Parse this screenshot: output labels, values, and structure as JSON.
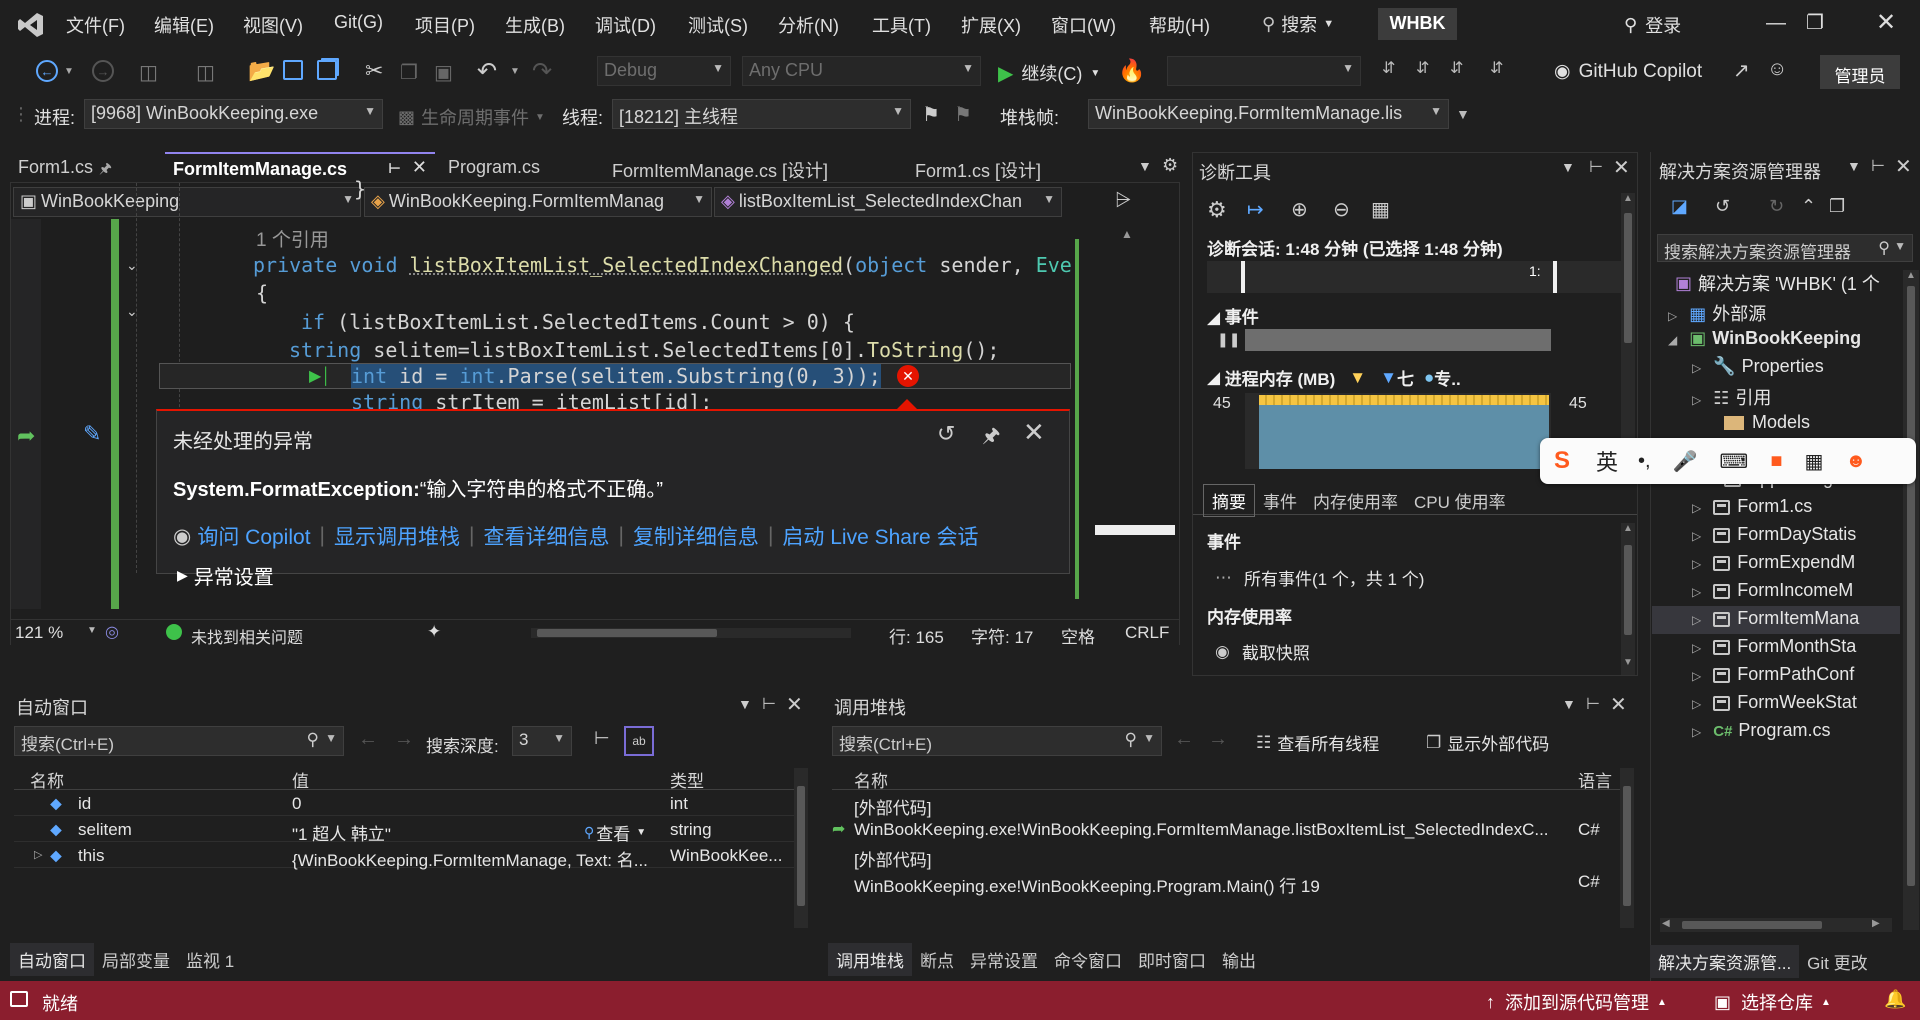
{
  "menubar": {
    "items": [
      "文件(F)",
      "编辑(E)",
      "视图(V)",
      "Git(G)",
      "项目(P)",
      "生成(B)",
      "调试(D)",
      "测试(S)",
      "分析(N)",
      "工具(T)",
      "扩展(X)",
      "窗口(W)",
      "帮助(H)"
    ],
    "search": "搜索",
    "solution_badge": "WHBK",
    "login": "登录"
  },
  "toolbar1": {
    "config": "Debug",
    "platform": "Any CPU",
    "continue": "继续(C)",
    "copilot": "GitHub Copilot",
    "admin": "管理员"
  },
  "toolbar2": {
    "process_label": "进程:",
    "process": "[9968] WinBookKeeping.exe",
    "lifecycle": "生命周期事件",
    "thread_label": "线程:",
    "thread": "[18212] 主线程",
    "stackframe_label": "堆栈帧:",
    "stackframe": "WinBookKeeping.FormItemManage.lis"
  },
  "editor_tabs": [
    {
      "label": "Form1.cs"
    },
    {
      "label": "FormItemManage.cs"
    },
    {
      "label": "Program.cs"
    },
    {
      "label": "FormItemManage.cs [设计]"
    },
    {
      "label": "Form1.cs [设计]"
    }
  ],
  "nav": {
    "project": "WinBookKeeping",
    "class": "WinBookKeeping.FormItemManag",
    "member": "listBoxItemList_SelectedIndexChan"
  },
  "code": {
    "brace_close": "}",
    "refs": "1 个引用",
    "sig_kw": "private void",
    "sig_name": "listBoxItemList_SelectedIndexChanged",
    "sig_args_kw": "object",
    "sig_args": "sender,",
    "sig_tail": "Even",
    "brace_open": "{",
    "line_if_kw": "if",
    "line_if": "(listBoxItemList.SelectedItems.Count > 0) {",
    "line_str_kw": "string",
    "line_str": "selitem=listBoxItemList.SelectedItems[0].",
    "line_str_fn": "ToString",
    "line_str_end": "();",
    "line_int_kw": "int",
    "line_int_a": "id =",
    "line_int_kw2": "int",
    "line_int_b": ".Parse(selitem.Substring(0, 3));",
    "line_next_kw": "string",
    "line_next": "strItem = itemList[id];"
  },
  "exception": {
    "title": "未经处理的异常",
    "type": "System.FormatException:",
    "message": "“输入字符串的格式不正确。”",
    "links": [
      "询问 Copilot",
      "显示调用堆栈",
      "查看详细信息",
      "复制详细信息",
      "启动 Live Share 会话"
    ],
    "settings": "异常设置"
  },
  "editor_status": {
    "zoom": "121 %",
    "issues": "未找到相关问题",
    "line": "行: 165",
    "char": "字符: 17",
    "spaces": "空格",
    "eol": "CRLF"
  },
  "diag": {
    "title": "诊断工具",
    "session": "诊断会话: 1:48 分钟 (已选择 1:48 分钟)",
    "timeline_label": "1:",
    "events": "事件",
    "memory": "进程内存 (MB)",
    "legend": [
      "",
      "七",
      "专.."
    ],
    "mem_max_left": "45",
    "mem_max_right": "45",
    "tabs": [
      "摘要",
      "事件",
      "内存使用率",
      "CPU 使用率"
    ],
    "section_events": "事件",
    "all_events": "所有事件(1 个，共 1 个)",
    "section_memory": "内存使用率",
    "snapshot": "截取快照"
  },
  "solution": {
    "title": "解决方案资源管理器",
    "search": "搜索解决方案资源管理器",
    "solution_node": "解决方案 'WHBK' (1 个",
    "items": [
      {
        "label": "外部源"
      },
      {
        "label": "WinBookKeeping"
      },
      {
        "label": "Properties"
      },
      {
        "label": "引用"
      },
      {
        "label": "Models"
      },
      {
        "label": "App.config"
      },
      {
        "label": "Form1.cs"
      },
      {
        "label": "FormDayStatis"
      },
      {
        "label": "FormExpendM"
      },
      {
        "label": "FormIncomeM"
      },
      {
        "label": "FormItemMana"
      },
      {
        "label": "FormMonthSta"
      },
      {
        "label": "FormPathConf"
      },
      {
        "label": "FormWeekStat"
      },
      {
        "label": "Program.cs"
      }
    ],
    "bottom_tabs": [
      "解决方案资源管...",
      "Git 更改"
    ]
  },
  "ime": {
    "mode": "英"
  },
  "autos": {
    "title": "自动窗口",
    "search": "搜索(Ctrl+E)",
    "depth_label": "搜索深度:",
    "depth": "3",
    "headers": [
      "名称",
      "值",
      "类型"
    ],
    "rows": [
      {
        "name": "id",
        "value": "0",
        "type": "int"
      },
      {
        "name": "selitem",
        "value": "\"1 超人 韩立\"",
        "view": "查看",
        "type": "string"
      },
      {
        "name": "this",
        "value": "{WinBookKeeping.FormItemManage, Text: 名...",
        "type": "WinBookKee..."
      }
    ],
    "bottom_tabs": [
      "自动窗口",
      "局部变量",
      "监视 1"
    ]
  },
  "callstack": {
    "title": "调用堆栈",
    "search": "搜索(Ctrl+E)",
    "view_threads": "查看所有线程",
    "show_external": "显示外部代码",
    "headers": [
      "名称",
      "语言"
    ],
    "rows": [
      {
        "name": "[外部代码]",
        "lang": ""
      },
      {
        "name": "WinBookKeeping.exe!WinBookKeeping.FormItemManage.listBoxItemList_SelectedIndexC...",
        "lang": "C#"
      },
      {
        "name": "[外部代码]",
        "lang": ""
      },
      {
        "name": "WinBookKeeping.exe!WinBookKeeping.Program.Main() 行 19",
        "lang": "C#"
      }
    ],
    "bottom_tabs": [
      "调用堆栈",
      "断点",
      "异常设置",
      "命令窗口",
      "即时窗口",
      "输出"
    ]
  },
  "statusbar": {
    "ready": "就绪",
    "source_control": "添加到源代码管理",
    "repo": "选择仓库"
  },
  "colors": {
    "status_bg": "#8b1e2e",
    "accent": "#9184ee",
    "link": "#4da3ff",
    "error": "#e51400"
  }
}
